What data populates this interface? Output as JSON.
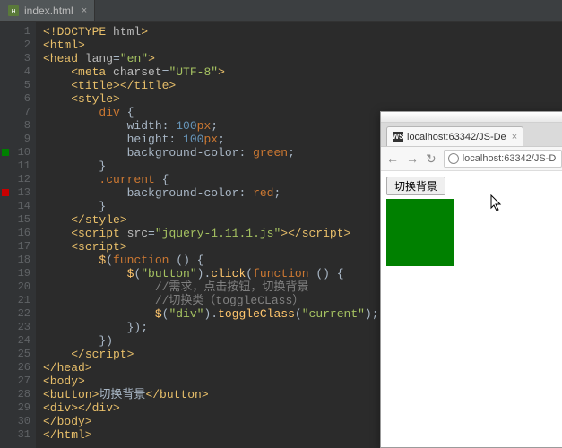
{
  "ide": {
    "tab": {
      "filename": "index.html"
    },
    "gutter": {
      "lines": 31,
      "markers": [
        {
          "line": 10,
          "color": "#008000"
        },
        {
          "line": 13,
          "color": "#c80000"
        }
      ]
    },
    "code": {
      "lines": [
        [
          [
            "tag",
            "<!DOCTYPE "
          ],
          [
            "attr",
            "html"
          ],
          [
            "tag",
            ">"
          ]
        ],
        [
          [
            "tag",
            "<html>"
          ]
        ],
        [
          [
            "tag",
            "<head "
          ],
          [
            "attr",
            "lang"
          ],
          [
            "punc",
            "="
          ],
          [
            "str",
            "\"en\""
          ],
          [
            "tag",
            ">"
          ]
        ],
        [
          [
            "guide",
            "    "
          ],
          [
            "tag",
            "<meta "
          ],
          [
            "attr",
            "charset"
          ],
          [
            "punc",
            "="
          ],
          [
            "str",
            "\"UTF-8\""
          ],
          [
            "tag",
            ">"
          ]
        ],
        [
          [
            "guide",
            "    "
          ],
          [
            "tag",
            "<title></title>"
          ]
        ],
        [
          [
            "guide",
            "    "
          ],
          [
            "tag",
            "<style>"
          ]
        ],
        [
          [
            "guide",
            "        "
          ],
          [
            "kw",
            "div "
          ],
          [
            "punc",
            "{"
          ]
        ],
        [
          [
            "guide",
            "            "
          ],
          [
            "txt",
            "width: "
          ],
          [
            "num",
            "100"
          ],
          [
            "kw",
            "px"
          ],
          [
            "punc",
            ";"
          ]
        ],
        [
          [
            "guide",
            "            "
          ],
          [
            "txt",
            "height: "
          ],
          [
            "num",
            "100"
          ],
          [
            "kw",
            "px"
          ],
          [
            "punc",
            ";"
          ]
        ],
        [
          [
            "guide",
            "            "
          ],
          [
            "txt",
            "background-color: "
          ],
          [
            "kw",
            "green"
          ],
          [
            "punc",
            ";"
          ]
        ],
        [
          [
            "guide",
            "        "
          ],
          [
            "punc",
            "}"
          ]
        ],
        [
          [
            "guide",
            "        "
          ],
          [
            "kw",
            ".current "
          ],
          [
            "punc",
            "{"
          ]
        ],
        [
          [
            "guide",
            "            "
          ],
          [
            "txt",
            "background-color: "
          ],
          [
            "kw",
            "red"
          ],
          [
            "punc",
            ";"
          ]
        ],
        [
          [
            "guide",
            "        "
          ],
          [
            "punc",
            "}"
          ]
        ],
        [
          [
            "guide",
            "    "
          ],
          [
            "tag",
            "</style>"
          ]
        ],
        [
          [
            "guide",
            "    "
          ],
          [
            "tag",
            "<script "
          ],
          [
            "attr",
            "src"
          ],
          [
            "punc",
            "="
          ],
          [
            "str",
            "\"jquery-1.11.1.js\""
          ],
          [
            "tag",
            "></script>"
          ]
        ],
        [
          [
            "guide",
            "    "
          ],
          [
            "tag",
            "<script>"
          ]
        ],
        [
          [
            "guide",
            "        "
          ],
          [
            "fn",
            "$"
          ],
          [
            "punc",
            "("
          ],
          [
            "kw",
            "function "
          ],
          [
            "punc",
            "() {"
          ]
        ],
        [
          [
            "guide",
            "            "
          ],
          [
            "fn",
            "$"
          ],
          [
            "punc",
            "("
          ],
          [
            "str",
            "\"button\""
          ],
          [
            "punc",
            ")."
          ],
          [
            "fn",
            "click"
          ],
          [
            "punc",
            "("
          ],
          [
            "kw",
            "function "
          ],
          [
            "punc",
            "() {"
          ]
        ],
        [
          [
            "guide",
            "                "
          ],
          [
            "cmt",
            "//需求，点击按钮，切换背景"
          ]
        ],
        [
          [
            "guide",
            "                "
          ],
          [
            "cmt",
            "//切换类（toggleCLass）"
          ]
        ],
        [
          [
            "guide",
            "                "
          ],
          [
            "fn",
            "$"
          ],
          [
            "punc",
            "("
          ],
          [
            "str",
            "\"div\""
          ],
          [
            "punc",
            ")."
          ],
          [
            "fn",
            "toggleClass"
          ],
          [
            "punc",
            "("
          ],
          [
            "str",
            "\"current\""
          ],
          [
            "punc",
            ");"
          ]
        ],
        [
          [
            "guide",
            "            "
          ],
          [
            "punc",
            "});"
          ]
        ],
        [
          [
            "guide",
            "        "
          ],
          [
            "punc",
            "})"
          ]
        ],
        [
          [
            "guide",
            "    "
          ],
          [
            "tag",
            "</script>"
          ]
        ],
        [
          [
            "tag",
            "</head>"
          ]
        ],
        [
          [
            "tag",
            "<body>"
          ]
        ],
        [
          [
            "tag",
            "<button>"
          ],
          [
            "txt",
            "切换背景"
          ],
          [
            "tag",
            "</button>"
          ]
        ],
        [
          [
            "tag",
            "<div></div>"
          ]
        ],
        [
          [
            "tag",
            "</body>"
          ]
        ],
        [
          [
            "tag",
            "</html>"
          ]
        ]
      ]
    }
  },
  "browser": {
    "tab_title": "localhost:63342/JS-De",
    "favicon_text": "WS",
    "url": "localhost:63342/JS-D",
    "page": {
      "button_label": "切换背景",
      "box_color": "green"
    }
  }
}
